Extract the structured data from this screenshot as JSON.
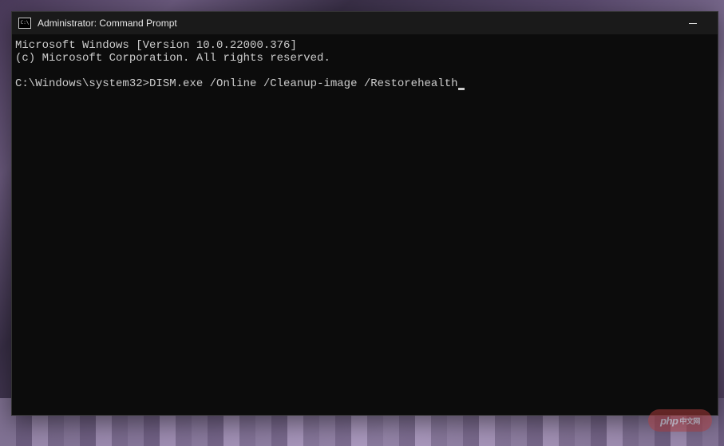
{
  "window": {
    "title": "Administrator: Command Prompt"
  },
  "terminal": {
    "header_line1": "Microsoft Windows [Version 10.0.22000.376]",
    "header_line2": "(c) Microsoft Corporation. All rights reserved.",
    "prompt": "C:\\Windows\\system32>",
    "command": "DISM.exe /Online /Cleanup-image /Restorehealth"
  },
  "watermark": {
    "brand": "php",
    "suffix": "中文网"
  }
}
